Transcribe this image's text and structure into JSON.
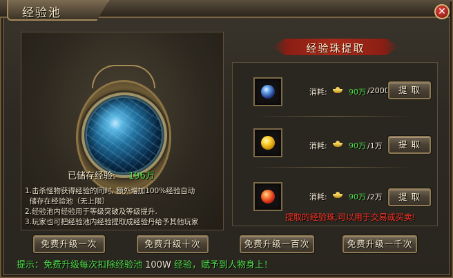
{
  "window": {
    "title": "经验池",
    "close_label": "✕"
  },
  "pool": {
    "stored_label": "已储存经验:",
    "stored_value": "196万",
    "notes": [
      "1.击杀怪物获得经验的同时, 额外增加100%经验自动",
      "  储存在经验池（无上限）",
      "2.经验池内经验用于等级突破及等级提升.",
      "3.玩家也可把经验池内经验提取成经验丹给予其他玩家"
    ]
  },
  "extract": {
    "title": "经验珠提取",
    "rows": [
      {
        "bead_icon": "blue-orb",
        "cost_label": "消耗:",
        "have": "90万",
        "need": "/2000",
        "button": "提 取"
      },
      {
        "bead_icon": "gold-orb",
        "cost_label": "消耗:",
        "have": "90万",
        "need": "/1万",
        "button": "提 取"
      },
      {
        "bead_icon": "red-orb",
        "cost_label": "消耗:",
        "have": "90万",
        "need": "/2万",
        "button": "提 取"
      }
    ],
    "trade_note": "提取的经验珠,可以用于交易或买卖!"
  },
  "upgrade_buttons": [
    {
      "label": "免费升级一次"
    },
    {
      "label": "免费升级十次"
    },
    {
      "label": "免费升级一百次"
    },
    {
      "label": "免费升级一千次"
    }
  ],
  "tip": {
    "prefix": "提示：免费升级每次扣除经验池",
    "amount": "100W",
    "suffix": "经验，赋予到人物身上！"
  },
  "colors": {
    "highlight_green": "#4fe04a",
    "warning_red": "#ff3324",
    "frame_gold": "#8e7a55"
  }
}
